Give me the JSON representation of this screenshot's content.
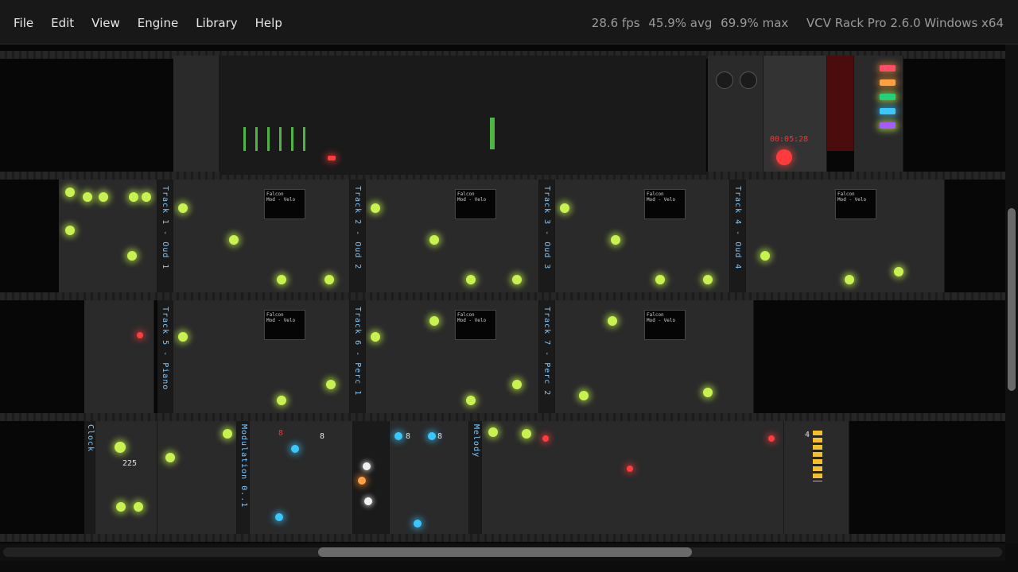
{
  "menu": {
    "items": [
      "File",
      "Edit",
      "View",
      "Engine",
      "Library",
      "Help"
    ]
  },
  "status": {
    "fps": "28.6 fps",
    "avg": "45.9% avg",
    "max": "69.9% max",
    "app": "VCV Rack Pro 2.6.0 Windows x64"
  },
  "tracks": {
    "t1": "Track 1 - Oud 1",
    "t2": "Track 2 - Oud 2",
    "t3": "Track 3 - Oud 3",
    "t4": "Track 4 - Oud 4",
    "t5": "Track 5 - Piano",
    "t6": "Track 6 - Perc 1",
    "t7": "Track 7 - Perc 2",
    "clock": "Clock",
    "modulation": "Modulation 0..1",
    "melody": "Melody"
  },
  "modules": {
    "falcon_name": "Falcon",
    "falcon_line": "Mod - Velo",
    "clock_bpm": "225",
    "seq_val": "8",
    "counter_val": "4",
    "time": "00:05:28"
  },
  "colors": {
    "led_green": "#c8f250",
    "led_red": "#ff3b3b",
    "led_blue": "#38c8ff",
    "label_blue": "#7ec8ff"
  }
}
